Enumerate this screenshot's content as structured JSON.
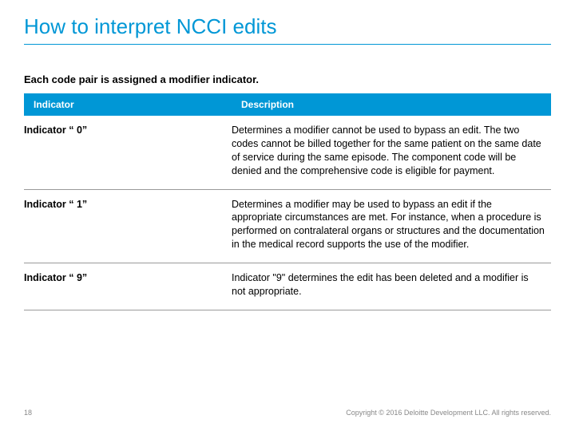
{
  "title": "How to interpret NCCI edits",
  "intro": "Each code pair is assigned a modifier indicator.",
  "headers": {
    "col1": "Indicator",
    "col2": "Description"
  },
  "rows": [
    {
      "indicator": "Indicator “ 0”",
      "description": "Determines a modifier cannot be used to bypass an edit.  The two codes cannot be billed together for the same patient on the same date of service during the same episode.  The component code will be denied and the comprehensive code is eligible for payment."
    },
    {
      "indicator": "Indicator “ 1”",
      "description": "Determines a modifier may be used to bypass an edit if the appropriate circumstances are met.  For instance, when a procedure is performed on contralateral organs or structures and the documentation in the medical record supports the use of the modifier."
    },
    {
      "indicator": "Indicator “ 9”",
      "description": "Indicator \"9\" determines the edit has been deleted and a modifier is not appropriate."
    }
  ],
  "footer": {
    "page": "18",
    "copyright": "Copyright © 2016 Deloitte Development LLC. All rights reserved."
  }
}
